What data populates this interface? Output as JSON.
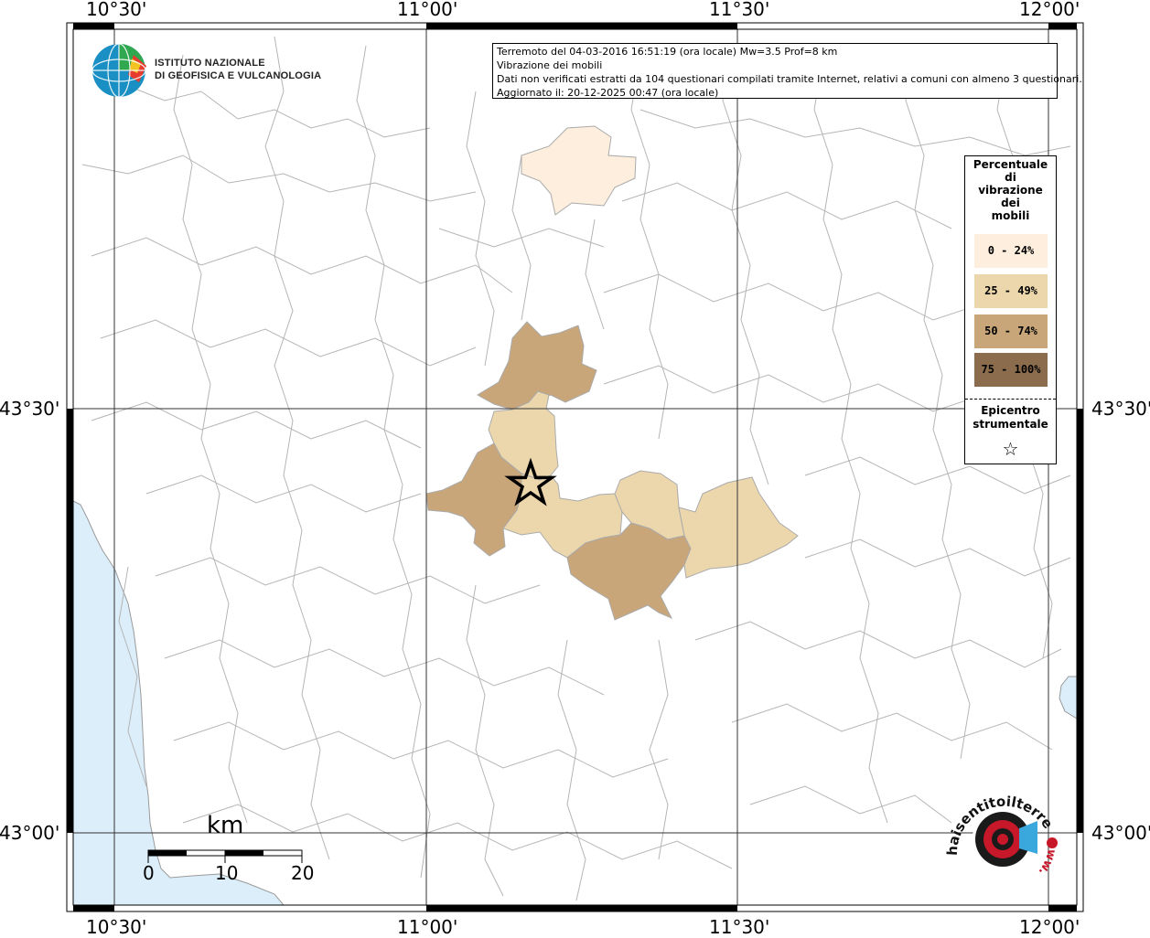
{
  "map": {
    "lon_labels": [
      "10°30'",
      "11°00'",
      "11°30'",
      "12°00'"
    ],
    "lat_labels": [
      "43°30'",
      "43°00'"
    ]
  },
  "logo": {
    "institute_line1": "ISTITUTO NAZIONALE",
    "institute_line2": "DI GEOFISICA E VULCANOLOGIA"
  },
  "info": {
    "line1": "Terremoto del 04-03-2016 16:51:19 (ora locale) Mw=3.5 Prof=8 km",
    "line2": "Vibrazione dei mobili",
    "line3": "Dati non verificati estratti da 104 questionari compilati tramite Internet, relativi a comuni con almeno 3 questionari.",
    "line4": "Aggiornato il: 20-12-2025 00:47 (ora locale)"
  },
  "legend": {
    "title_line1": "Percentuale",
    "title_line2": "di",
    "title_line3": "vibrazione",
    "title_line4": "dei",
    "title_line5": "mobili",
    "classes": [
      {
        "label": "0 - 24%",
        "color": "#fdeedd"
      },
      {
        "label": "25 - 49%",
        "color": "#ecd7ad"
      },
      {
        "label": "50 - 74%",
        "color": "#c8a67a"
      },
      {
        "label": "75 - 100%",
        "color": "#8b6c4c"
      }
    ],
    "epicenter_line1": "Epicentro",
    "epicenter_line2": "strumentale",
    "star": "☆"
  },
  "scale": {
    "unit": "km",
    "ticks": [
      "0",
      "10",
      "20"
    ]
  },
  "site_logo": {
    "text": "haisentitoilterremoto.it",
    "www": "www."
  },
  "colors": {
    "sea": "#dbeefa",
    "border": "#9a9a9a",
    "grid": "#333333"
  }
}
